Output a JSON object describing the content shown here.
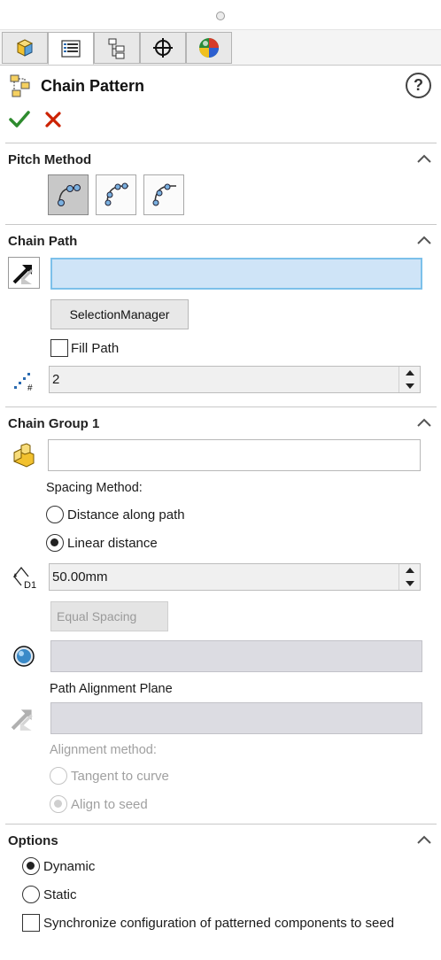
{
  "tabs": [
    {
      "icon": "featuremanager-icon"
    },
    {
      "icon": "propertymanager-icon"
    },
    {
      "icon": "configurationmanager-icon"
    },
    {
      "icon": "dimxpert-icon"
    },
    {
      "icon": "displaymanager-icon"
    }
  ],
  "header": {
    "title": "Chain Pattern",
    "help": "?"
  },
  "actions": {
    "ok": "✔",
    "cancel": "✕"
  },
  "pitch_method": {
    "label": "Pitch Method",
    "options": [
      "distance-pitch",
      "distance-linkage",
      "connected-linkage"
    ],
    "selected": 0
  },
  "chain_path": {
    "label": "Chain Path",
    "path_value": "",
    "selection_manager_label": "SelectionManager",
    "fill_path_label": "Fill Path",
    "fill_path_checked": false,
    "instances_value": "2"
  },
  "chain_group": {
    "label": "Chain Group 1",
    "component_value": "",
    "spacing_method_label": "Spacing Method:",
    "distance_along_path_label": "Distance along path",
    "linear_distance_label": "Linear distance",
    "spacing_selected": "linear",
    "distance_value": "50.00mm",
    "equal_spacing_label": "Equal Spacing",
    "path_alignment_plane_label": "Path Alignment Plane",
    "alignment_method_label": "Alignment method:",
    "tangent_to_curve_label": "Tangent to curve",
    "align_to_seed_label": "Align to seed",
    "alignment_selected": "seed"
  },
  "options": {
    "label": "Options",
    "dynamic_label": "Dynamic",
    "static_label": "Static",
    "mode_selected": "dynamic",
    "sync_label": "Synchronize configuration of patterned components to seed",
    "sync_checked": false
  },
  "colors": {
    "accent_green": "#2e8b2e",
    "cancel_red": "#cc2200",
    "selection_blue": "#cfe4f7"
  }
}
